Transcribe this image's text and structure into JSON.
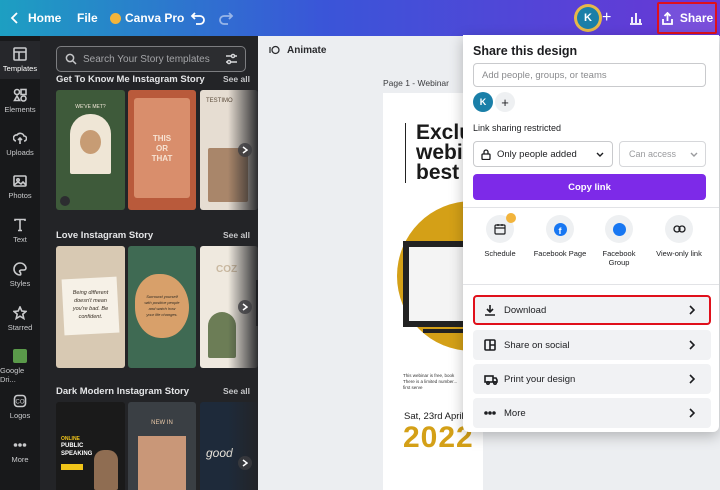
{
  "topbar": {
    "home_label": "Home",
    "file_label": "File",
    "pro_label": "Canva Pro",
    "avatar_letter": "K",
    "share_label": "Share"
  },
  "rail": {
    "items": [
      {
        "label": "Templates",
        "icon": "templates-icon"
      },
      {
        "label": "Elements",
        "icon": "elements-icon"
      },
      {
        "label": "Uploads",
        "icon": "uploads-icon"
      },
      {
        "label": "Photos",
        "icon": "photos-icon"
      },
      {
        "label": "Text",
        "icon": "text-icon"
      },
      {
        "label": "Styles",
        "icon": "styles-icon"
      },
      {
        "label": "Starred",
        "icon": "star-icon"
      },
      {
        "label": "Google Dri...",
        "icon": "google-drive-icon"
      },
      {
        "label": "Logos",
        "icon": "logos-icon"
      },
      {
        "label": "More",
        "icon": "more-icon"
      }
    ]
  },
  "panel": {
    "search_placeholder": "Search Your Story templates",
    "sections": [
      {
        "title": "Get To Know Me Instagram Story",
        "see_all": "See all"
      },
      {
        "title": "Love Instagram Story",
        "see_all": "See all"
      },
      {
        "title": "Dark Modern Instagram Story",
        "see_all": "See all"
      }
    ],
    "thumb_text": {
      "s1t1": "WE'VE MET?",
      "s1t2a": "THIS",
      "s1t2b": "OR",
      "s1t2c": "THAT",
      "s1t3": "TESTIMO",
      "s2t1a": "Being different",
      "s2t1b": "doesn't mean",
      "s2t1c": "you're bad. Be",
      "s2t1d": "confident.",
      "s2t2a": "Surround yourself",
      "s2t2b": "with positive people",
      "s2t2c": "and watch how",
      "s2t2d": "your life changes.",
      "s2t3": "COZ",
      "s3t1a": "ONLINE",
      "s3t1b": "PUBLIC",
      "s3t1c": "SPEAKING",
      "s3t2": "NEW IN",
      "s3t3": "good"
    }
  },
  "canvas": {
    "animate_label": "Animate",
    "page_label": "Page 1 - Webinar",
    "heading_lines": [
      "Exclu",
      "webi",
      "best"
    ],
    "small_text_1": "This webinar is free, book",
    "small_text_2": "There is a limited number...",
    "small_text_3": "first serve",
    "date_text": "Sat, 23rd April",
    "year_text": "2022"
  },
  "share": {
    "title": "Share this design",
    "people_placeholder": "Add people, groups, or teams",
    "avatar_letter": "K",
    "link_sharing": "Link sharing restricted",
    "access_dropdown": "Only people added",
    "can_access": "Can access",
    "copy_link": "Copy link",
    "options": [
      {
        "label": "Schedule",
        "icon": "calendar-icon"
      },
      {
        "label": "Facebook Page",
        "icon": "facebook-icon"
      },
      {
        "label": "Facebook Group",
        "icon": "facebook-group-icon"
      },
      {
        "label": "View-only link",
        "icon": "link-icon"
      }
    ],
    "download": "Download",
    "share_social": "Share on social",
    "print": "Print your design",
    "more": "More"
  },
  "colors": {
    "accent_purple": "#7d2ae8",
    "highlight_red": "#e0101b",
    "gold": "#d4a017",
    "facebook_blue": "#1877f2",
    "avatar_teal": "#1a7fa8"
  }
}
